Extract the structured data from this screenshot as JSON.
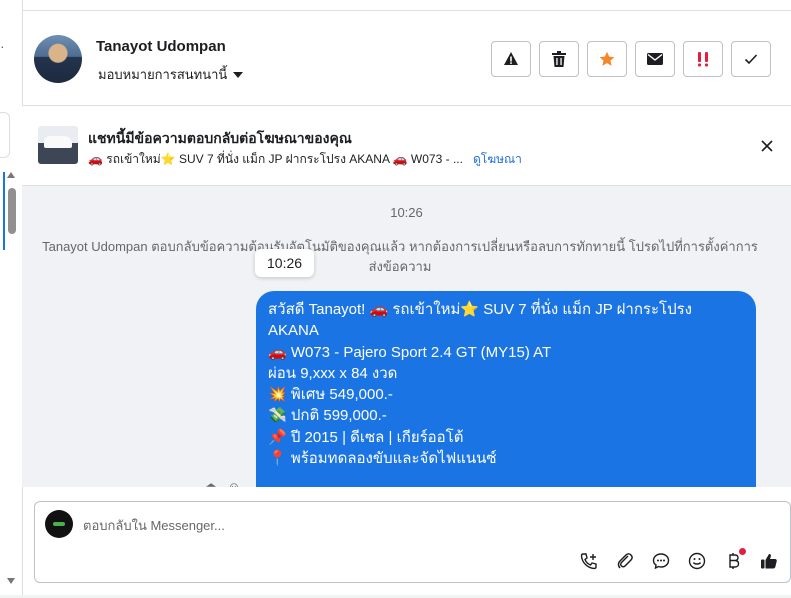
{
  "contact": {
    "name": "Tanayot Udompan",
    "assign_label": "มอบหมายการสนทนานี้"
  },
  "actions": [
    {
      "name": "warning-icon",
      "color": "#1c1e21"
    },
    {
      "name": "trash-icon",
      "color": "#1c1e21"
    },
    {
      "name": "star-icon",
      "color": "#f5862a"
    },
    {
      "name": "envelope-icon",
      "color": "#1c1e21"
    },
    {
      "name": "double-exclamation-icon",
      "color": "#e41e3f"
    },
    {
      "name": "checkmark-icon",
      "color": "#1c1e21"
    }
  ],
  "ad": {
    "title": "แชทนี้มีข้อความตอบกลับต่อโฆษณาของคุณ",
    "subtitle": "🚗 รถเข้าใหม่⭐ SUV 7 ที่นั่ง แม็ก JP ฝากระโปรง AKANA 🚗 W073 - ...",
    "link": "ดูโฆษณา"
  },
  "conversation": {
    "timestamp": "10:26",
    "system_message": "Tanayot Udompan ตอบกลับข้อความต้อนรับอัตโนมัติของคุณแล้ว หากต้องการเปลี่ยนหรือลบการทักทายนี้ โปรดไปที่การตั้งค่าการส่งข้อความ",
    "tooltip_time": "10:26",
    "message_lines": [
      "สวัสดี Tanayot! 🚗 รถเข้าใหม่⭐ SUV 7 ที่นั่ง แม็ก JP ฝากระโปรง",
      "AKANA",
      "🚗 W073 - Pajero Sport 2.4 GT (MY15) AT",
      "ผ่อน 9,xxx x 84 งวด",
      "💥 พิเศษ 549,000.-",
      "💸 ปกติ 599,000.-",
      "📌 ปี 2015 | ดีเซล | เกียร์ออโต้",
      "📍 พร้อมทดลองขับและจัดไฟแนนซ์"
    ]
  },
  "composer": {
    "placeholder": "ตอบกลับใน Messenger..."
  },
  "colors": {
    "accent": "#1b74e4",
    "background": "#f0f2f5"
  }
}
